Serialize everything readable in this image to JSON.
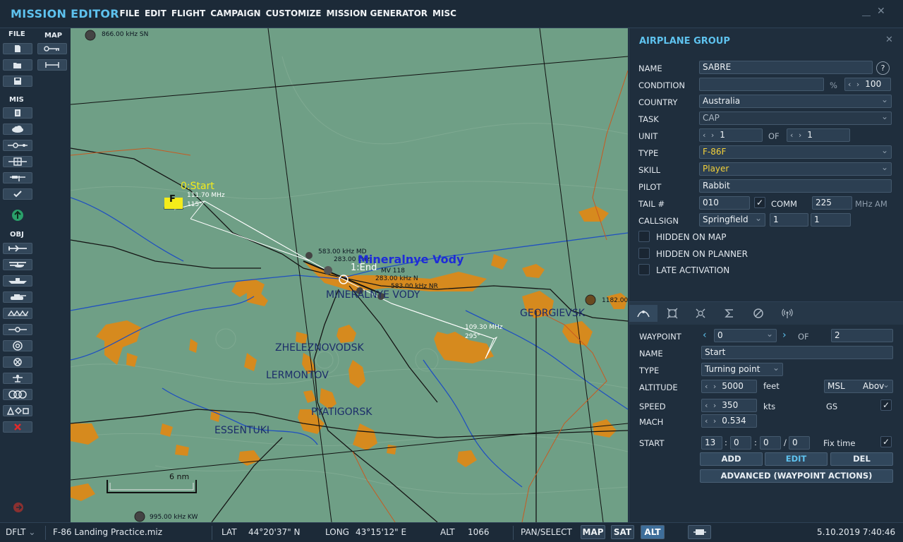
{
  "app": {
    "title": "MISSION EDITOR",
    "menu": [
      "FILE",
      "EDIT",
      "FLIGHT",
      "CAMPAIGN",
      "CUSTOMIZE",
      "MISSION GENERATOR",
      "MISC"
    ]
  },
  "leftbar": {
    "file_label": "FILE",
    "map_label": "MAP",
    "mis_label": "MIS",
    "obj_label": "OBJ",
    "file_tools": [
      "new-file-icon",
      "open-folder-icon",
      "save-icon"
    ],
    "map_tools": [
      "map-key-icon",
      "measure-ruler-icon"
    ],
    "mis_tools": [
      "briefing-icon",
      "weather-icon",
      "triggers-icon",
      "goals-icon",
      "flags-icon",
      "check-icon",
      "pin-up-icon"
    ],
    "obj_tools": [
      "airplane-icon",
      "helicopter-icon",
      "ship-icon",
      "ground-unit-icon",
      "static-object-icon",
      "navpoint-icon",
      "target-icon",
      "initial-point-icon",
      "bullseye-icon",
      "zone-icon",
      "shapes-icon",
      "delete-icon"
    ]
  },
  "map": {
    "frequencies": {
      "top_left": "866.00 kHz SN",
      "bottom_left": "995.00 kHz KW",
      "right": "1182.00",
      "md": "583.00 kHz MD",
      "mvd1": "283.00 kHz",
      "mvd2": "283.00 kHz N",
      "mvd3": "583.00 kHz NR",
      "mv_label": "MV 118",
      "start_ils": "111.70 MHz",
      "start_course": "115°",
      "end_ils": "109.30 MHz",
      "end_course": "295°"
    },
    "waypoints": {
      "start": "0:Start",
      "end": "1:End",
      "marker": "F"
    },
    "airfield": "Mineralnye Vody",
    "cities": [
      "MINERALNYE VODY",
      "GEORGIEVSK",
      "ZHELEZNOVODSK",
      "LERMONTOV",
      "PYATIGORSK",
      "ESSENTUKI"
    ],
    "scale": "6 nm",
    "colors": {
      "terrain": "#6f9f86",
      "towns": "#d68a1e",
      "roads": "#141414",
      "rivers": "#2050c0",
      "grid": "#111111",
      "route": "#ffffff"
    }
  },
  "panel": {
    "title": "AIRPLANE GROUP",
    "name_label": "NAME",
    "name": "SABRE",
    "help": "?",
    "condition_label": "CONDITION",
    "condition_unit": "%",
    "condition_value": "100",
    "country_label": "COUNTRY",
    "country": "Australia",
    "task_label": "TASK",
    "task": "CAP",
    "unit_label": "UNIT",
    "unit": "1",
    "unit_of": "OF",
    "unit_total": "1",
    "type_label": "TYPE",
    "type": "F-86F",
    "skill_label": "SKILL",
    "skill": "Player",
    "pilot_label": "PILOT",
    "pilot": "Rabbit",
    "tail_label": "TAIL #",
    "tail": "010",
    "comm_label": "COMM",
    "comm": "225",
    "comm_unit": "MHz",
    "comm_mod": "AM",
    "callsign_label": "CALLSIGN",
    "callsign": "Springfield",
    "callsign_n1": "1",
    "callsign_n2": "1",
    "hidden_map": "HIDDEN ON MAP",
    "hidden_planner": "HIDDEN ON PLANNER",
    "late_activation": "LATE ACTIVATION",
    "tabs": [
      "route-tab-icon",
      "targets-tab-icon",
      "payload-tab-icon",
      "summary-tab-icon",
      "failures-tab-icon",
      "radio-tab-icon"
    ],
    "wp_label": "WAYPOINT",
    "wp": "0",
    "wp_of": "OF",
    "wp_total": "2",
    "wp_name_label": "NAME",
    "wp_name": "Start",
    "wp_type_label": "TYPE",
    "wp_type": "Turning point",
    "alt_label": "ALTITUDE",
    "alt": "5000",
    "alt_unit": "feet",
    "alt_ref": "MSL",
    "alt_ref2": "Abov",
    "speed_label": "SPEED",
    "speed": "350",
    "speed_unit": "kts",
    "gs": "GS",
    "mach_label": "MACH",
    "mach": "0.534",
    "start_label": "START",
    "start_d": "13",
    "start_h": "0",
    "start_m": "0",
    "start_s": "0",
    "fix_time": "Fix time",
    "add": "ADD",
    "edit": "EDIT",
    "del": "DEL",
    "advanced": "ADVANCED (WAYPOINT ACTIONS)"
  },
  "status": {
    "mode": "DFLT",
    "file": "F-86 Landing Practice.miz",
    "lat_label": "LAT",
    "lat": "44°20'37\" N",
    "long_label": "LONG",
    "long": "43°15'12\" E",
    "alt_label": "ALT",
    "alt": "1066",
    "pan_select": "PAN/SELECT",
    "map_btn": "MAP",
    "sat_btn": "SAT",
    "alt_btn": "ALT",
    "datetime": "5.10.2019 7:40:46"
  }
}
